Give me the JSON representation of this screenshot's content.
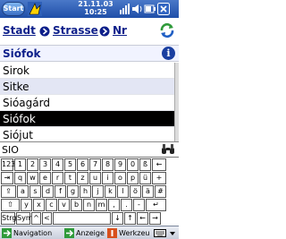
{
  "titlebar": {
    "start_label": "Start",
    "date": "21.11.03",
    "time": "10:25"
  },
  "breadcrumb": {
    "city": "Stadt",
    "street": "Strasse",
    "number": "Nr"
  },
  "selected": {
    "place": "Siófok"
  },
  "list": {
    "items": [
      "Sirok",
      "Sitke",
      "Sióagárd",
      "Siófok",
      "Siójut"
    ],
    "selected_index": 3
  },
  "search": {
    "value": "SIO"
  },
  "keyboard": {
    "rows": [
      [
        {
          "l": "123"
        },
        {
          "l": "1"
        },
        {
          "l": "2"
        },
        {
          "l": "3"
        },
        {
          "l": "4"
        },
        {
          "l": "5"
        },
        {
          "l": "6"
        },
        {
          "l": "7"
        },
        {
          "l": "8"
        },
        {
          "l": "9"
        },
        {
          "l": "0"
        },
        {
          "l": "ß"
        },
        {
          "l": "←"
        }
      ],
      [
        {
          "l": "⇥"
        },
        {
          "l": "q"
        },
        {
          "l": "w"
        },
        {
          "l": "e"
        },
        {
          "l": "r"
        },
        {
          "l": "t"
        },
        {
          "l": "z"
        },
        {
          "l": "u"
        },
        {
          "l": "i"
        },
        {
          "l": "o"
        },
        {
          "l": "p"
        },
        {
          "l": "ü"
        },
        {
          "l": "+"
        }
      ],
      [
        {
          "l": "⇪"
        },
        {
          "l": "a"
        },
        {
          "l": "s"
        },
        {
          "l": "d"
        },
        {
          "l": "f"
        },
        {
          "l": "g"
        },
        {
          "l": "h"
        },
        {
          "l": "j"
        },
        {
          "l": "k"
        },
        {
          "l": "l"
        },
        {
          "l": "ö"
        },
        {
          "l": "ä"
        },
        {
          "l": "#"
        }
      ],
      [
        {
          "l": "⇧"
        },
        {
          "l": "y"
        },
        {
          "l": "x"
        },
        {
          "l": "c"
        },
        {
          "l": "v"
        },
        {
          "l": "b"
        },
        {
          "l": "n"
        },
        {
          "l": "m"
        },
        {
          "l": ","
        },
        {
          "l": "."
        },
        {
          "l": "-"
        },
        {
          "l": "↵"
        }
      ],
      [
        {
          "l": "Strg"
        },
        {
          "l": "Sym"
        },
        {
          "l": "^"
        },
        {
          "l": "<"
        },
        {
          "l": ""
        },
        {
          "l": "↓"
        },
        {
          "l": "↑"
        },
        {
          "l": "←"
        },
        {
          "l": "→"
        }
      ]
    ]
  },
  "menubar": {
    "navigation": "Navigation",
    "anzeige": "Anzeige",
    "werkzeug": "Werkzeu"
  },
  "colors": {
    "titlebar": "#1f4fa8",
    "link": "#0d1f8a",
    "selection": "#000000",
    "alt_row": "#e3e6f4"
  }
}
